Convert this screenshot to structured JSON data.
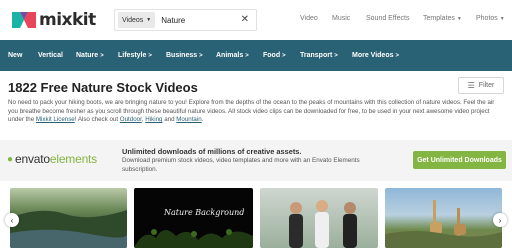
{
  "brand": {
    "logo_text": "mixkit"
  },
  "search": {
    "category": "Videos",
    "value": "Nature",
    "clear_icon": "close-icon"
  },
  "topnav": {
    "video": "Video",
    "music": "Music",
    "sound_effects": "Sound Effects",
    "templates": "Templates",
    "photos": "Photos"
  },
  "category_nav": [
    {
      "label": "New"
    },
    {
      "label": "Vertical"
    },
    {
      "label": "Nature",
      "arrow": ">"
    },
    {
      "label": "Lifestyle",
      "arrow": ">"
    },
    {
      "label": "Business",
      "arrow": ">"
    },
    {
      "label": "Animals",
      "arrow": ">"
    },
    {
      "label": "Food",
      "arrow": ">"
    },
    {
      "label": "Transport",
      "arrow": ">"
    },
    {
      "label": "More Videos",
      "arrow": ">"
    }
  ],
  "page": {
    "title": "1822 Free Nature Stock Videos",
    "filter_label": "Filter",
    "description_parts": [
      "No need to pack your hiking boots, we are bringing nature to you! Explore from the depths of the ocean to the peaks of mountains with this collection of nature videos. Feel the air you breathe become fresher as you scroll through these beautiful nature videos. All stock video clips can be downloaded for free, to be used in your next awesome video project under the ",
      "Mixkit License",
      "! Also check out ",
      "Outdoor",
      ", ",
      "Hiking",
      " and ",
      "Mountain",
      "."
    ]
  },
  "banner": {
    "logo_part1": "envato",
    "logo_part2": "elements",
    "heading": "Unlimited downloads of millions of creative assets.",
    "subtext": "Download premium stock videos, video templates and more with an Envato Elements subscription.",
    "cta": "Get Unlimited Downloads"
  },
  "thumbnail_overlay_text": "Nature Background",
  "colors": {
    "nav_bg": "#2a6275",
    "envato_green": "#82b541",
    "link": "#2a6275"
  }
}
